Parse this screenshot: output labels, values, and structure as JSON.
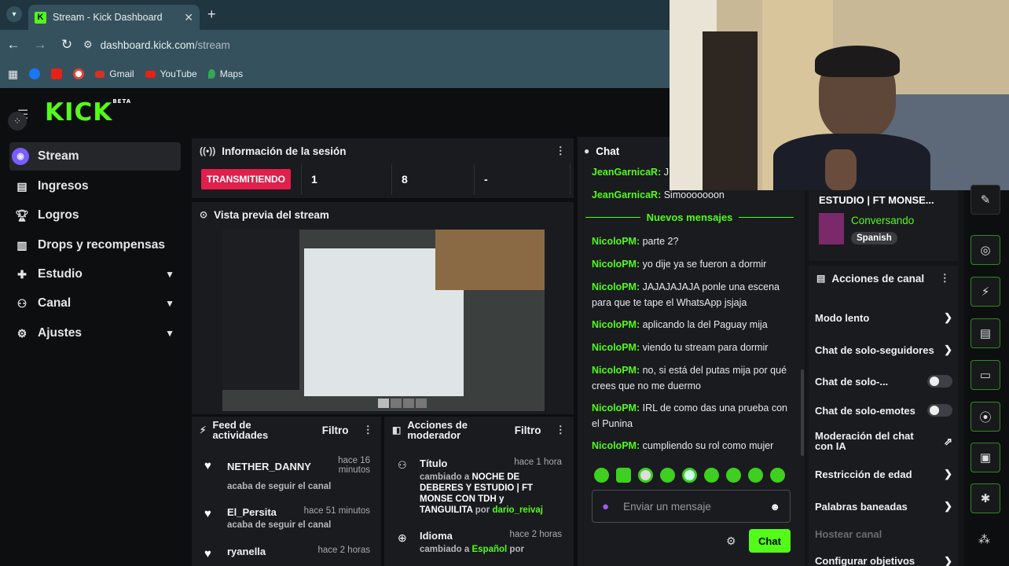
{
  "browser": {
    "tab_title": "Stream - Kick Dashboard",
    "tab_logo": "K",
    "url_host": "dashboard.kick.com",
    "url_path": "/stream",
    "bookmarks": [
      "Gmail",
      "YouTube",
      "Maps"
    ]
  },
  "brand": {
    "logo": "KICK",
    "beta": "BETA",
    "accent": "#53fc18"
  },
  "sidebar": {
    "items": [
      {
        "label": "Stream",
        "icon": "stream-icon"
      },
      {
        "label": "Ingresos",
        "icon": "revenue-icon"
      },
      {
        "label": "Logros",
        "icon": "trophy-icon"
      },
      {
        "label": "Drops y recompensas",
        "icon": "drops-icon"
      },
      {
        "label": "Estudio",
        "icon": "studio-icon"
      },
      {
        "label": "Canal",
        "icon": "channel-icon"
      },
      {
        "label": "Ajustes",
        "icon": "settings-icon"
      }
    ]
  },
  "session": {
    "title": "Información de la sesión",
    "status": "TRANSMITIENDO",
    "stats": [
      "1",
      "8",
      "-"
    ]
  },
  "preview": {
    "title": "Vista previa del stream"
  },
  "activity": {
    "title": "Feed de actividades",
    "filter": "Filtro",
    "items": [
      {
        "name": "NETHER_DANNY",
        "time": "hace 16 minutos",
        "sub": "acaba de seguir el canal"
      },
      {
        "name": "El_Persita",
        "time": "hace 51 minutos",
        "sub": "acaba de seguir el canal"
      },
      {
        "name": "ryanella",
        "time": "hace 2 horas",
        "sub": ""
      }
    ]
  },
  "modactions": {
    "title": "Acciones de moderador",
    "filter": "Filtro",
    "items": [
      {
        "name": "Título",
        "time": "hace 1 hora",
        "prefix": "cambiado a",
        "value": "NOCHE DE DEBERES Y ESTUDIO | FT MONSE CON TDH y TANGUILITA",
        "by": "por",
        "user": "dario_reivaj"
      },
      {
        "name": "Idioma",
        "time": "hace 2 horas",
        "prefix": "cambiado a",
        "value": "Español",
        "by": "por",
        "user": ""
      }
    ]
  },
  "chat": {
    "title": "Chat",
    "new_messages": "Nuevos mensajes",
    "input_placeholder": "Enviar un mensaje",
    "send": "Chat",
    "messages": [
      {
        "user": "JeanGarnicaR:",
        "text": "J"
      },
      {
        "user": "JeanGarnicaR:",
        "text": "Simooooooon"
      },
      {
        "user": "NicoloPM:",
        "text": "parte 2?"
      },
      {
        "user": "NicoloPM:",
        "text": "yo dije ya se fueron a dormir"
      },
      {
        "user": "NicoloPM:",
        "text": "JAJAJAJAJA ponle una escena para que te tape el WhatsApp jsjaja"
      },
      {
        "user": "NicoloPM:",
        "text": "aplicando la del Paguay mija"
      },
      {
        "user": "NicoloPM:",
        "text": "viendo tu stream para dormir"
      },
      {
        "user": "NicoloPM:",
        "text": "no, si está del putas mija por qué crees que no me duermo"
      },
      {
        "user": "NicoloPM:",
        "text": "IRL de como das una prueba con el Punina"
      },
      {
        "user": "NicoloPM:",
        "text": "cumpliendo su rol como mujer"
      }
    ]
  },
  "streaminfo": {
    "title": "ESTUDIO | FT MONSE...",
    "category": "Conversando",
    "language": "Spanish"
  },
  "channel_actions": {
    "title": "Acciones de canal",
    "items": [
      {
        "label": "Modo lento",
        "type": "arrow"
      },
      {
        "label": "Chat de solo-seguidores",
        "type": "arrow"
      },
      {
        "label": "Chat de solo-...",
        "type": "toggle"
      },
      {
        "label": "Chat de solo-emotes",
        "type": "toggle"
      },
      {
        "label": "Moderación del chat con IA",
        "type": "external"
      },
      {
        "label": "Restricción de edad",
        "type": "arrow"
      },
      {
        "label": "Palabras baneadas",
        "type": "arrow"
      },
      {
        "label": "Hostear canal",
        "type": "disabled"
      },
      {
        "label": "Configurar objetivos",
        "type": "arrow"
      }
    ]
  }
}
